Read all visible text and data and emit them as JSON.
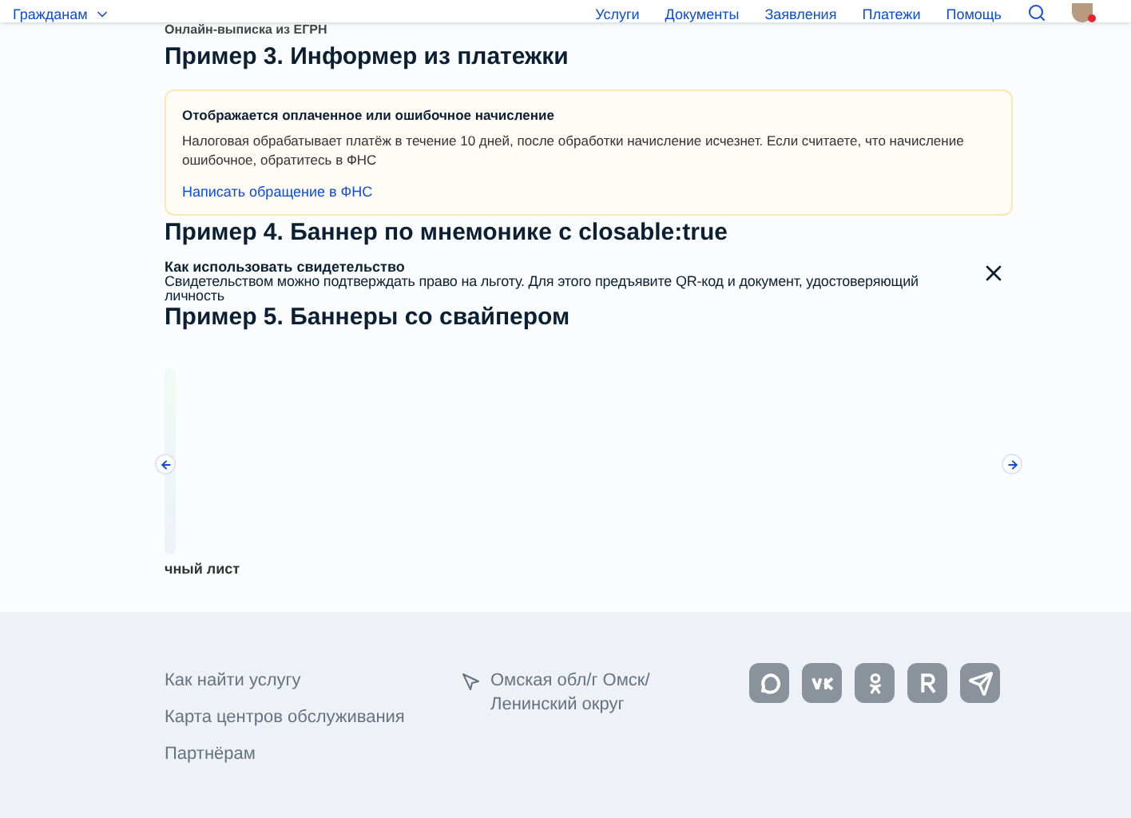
{
  "header": {
    "menu": "Гражданам",
    "nav": [
      "Услуги",
      "Документы",
      "Заявления",
      "Платежи",
      "Помощь"
    ],
    "avatar_notification": true
  },
  "cut_caption": "Онлайн-выписка из ЕГРН",
  "example3": {
    "title": "Пример 3. Информер из платежки",
    "informer": {
      "heading": "Отображается оплаченное или ошибочное начисление",
      "text": "Налоговая обрабатывает платёж в течение 10 дней, после обработки начисление исчезнет. Если считаете, что начисление ошибочное, обратитесь в ФНС",
      "link": "Написать обращение в ФНС"
    }
  },
  "example4": {
    "title": "Пример 4. Баннер по мнемонике с closable:true",
    "banner": {
      "heading": "Как использовать свидетельство",
      "text": "Свидетельством можно подтверждать право на льготу. Для этого предъявите QR-код и документ, удостоверяющий личность",
      "closable": true
    }
  },
  "example5": {
    "title": "Пример 5. Баннеры со свайпером",
    "slide_caption": "чный лист"
  },
  "footer": {
    "links": [
      "Как найти услугу",
      "Карта центров обслуживания",
      "Партнёрам"
    ],
    "location": "Омская обл/г Омск/ Ленинский округ",
    "socials": [
      {
        "kind": "chat"
      },
      {
        "kind": "vk"
      },
      {
        "kind": "ok"
      },
      {
        "kind": "r"
      },
      {
        "kind": "telegram"
      }
    ]
  }
}
